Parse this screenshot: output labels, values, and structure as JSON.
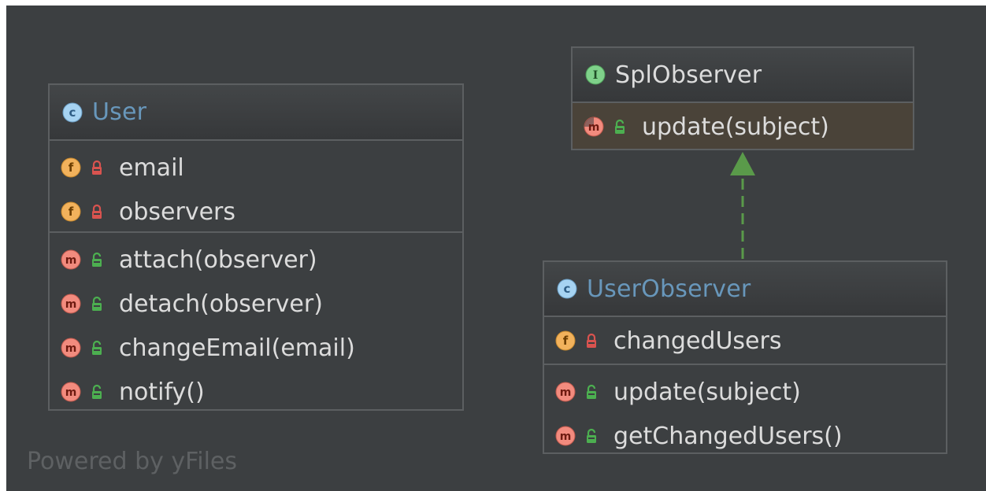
{
  "colors": {
    "canvas_bg": "#3c3f41",
    "class_name": "#6897bb",
    "interface_name": "#dcdcdc",
    "member_text": "#dcdcdc",
    "border": "#5c5f61",
    "implements_arrow": "#5a9a4a",
    "watermark": "#5e6163"
  },
  "classes": {
    "user": {
      "kind": "class",
      "kind_icon": "class-icon",
      "kind_letter": "c",
      "name": "User",
      "fields": [
        {
          "name": "email",
          "kind_letter": "f",
          "visibility": "private",
          "icon": "field-icon"
        },
        {
          "name": "observers",
          "kind_letter": "f",
          "visibility": "private",
          "icon": "field-icon"
        }
      ],
      "methods": [
        {
          "name": "attach(observer)",
          "kind_letter": "m",
          "visibility": "public",
          "icon": "method-icon"
        },
        {
          "name": "detach(observer)",
          "kind_letter": "m",
          "visibility": "public",
          "icon": "method-icon"
        },
        {
          "name": "changeEmail(email)",
          "kind_letter": "m",
          "visibility": "public",
          "icon": "method-icon"
        },
        {
          "name": "notify()",
          "kind_letter": "m",
          "visibility": "public",
          "icon": "method-icon"
        }
      ]
    },
    "splobserver": {
      "kind": "interface",
      "kind_icon": "interface-icon",
      "kind_letter": "I",
      "name": "SplObserver",
      "methods": [
        {
          "name": "update(subject)",
          "kind_letter": "m",
          "visibility": "public",
          "icon": "abstract-method-icon"
        }
      ]
    },
    "userobserver": {
      "kind": "class",
      "kind_icon": "class-icon",
      "kind_letter": "c",
      "name": "UserObserver",
      "fields": [
        {
          "name": "changedUsers",
          "kind_letter": "f",
          "visibility": "private",
          "icon": "field-icon"
        }
      ],
      "methods": [
        {
          "name": "update(subject)",
          "kind_letter": "m",
          "visibility": "public",
          "icon": "method-icon"
        },
        {
          "name": "getChangedUsers()",
          "kind_letter": "m",
          "visibility": "public",
          "icon": "method-icon"
        }
      ]
    }
  },
  "relations": [
    {
      "from": "UserObserver",
      "to": "SplObserver",
      "type": "implements",
      "style": "dashed",
      "head": "filled-triangle"
    }
  ],
  "watermark": "Powered by yFiles"
}
